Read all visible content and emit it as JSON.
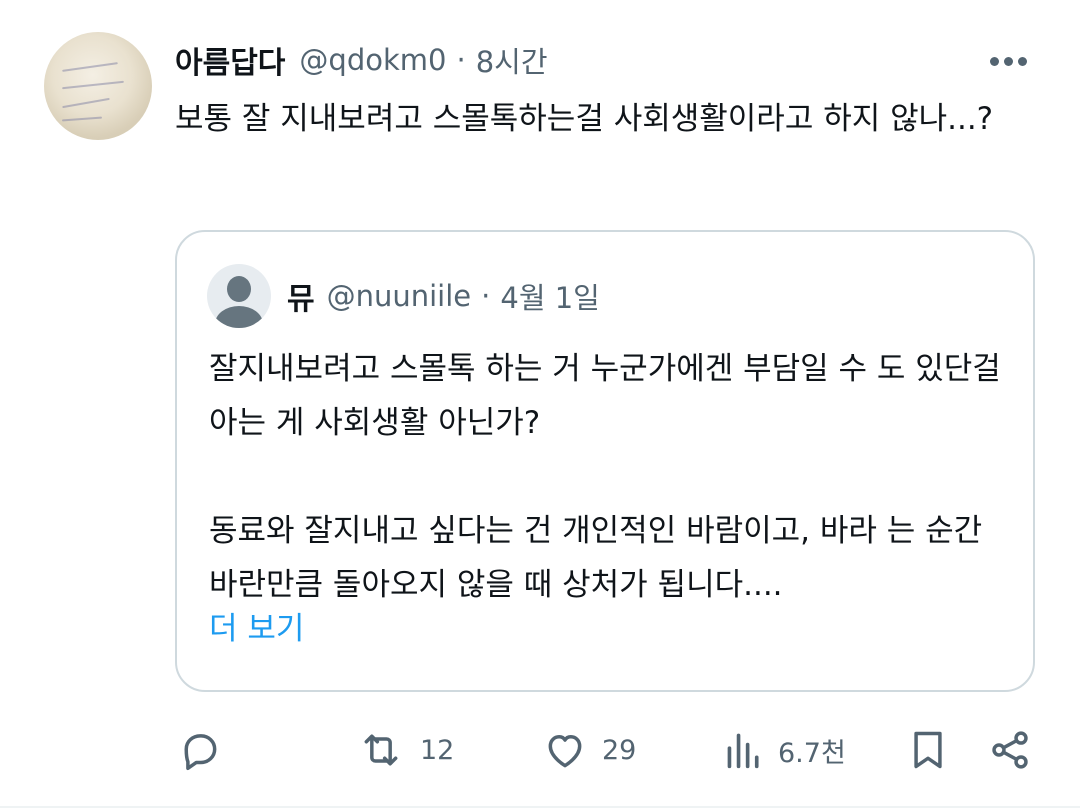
{
  "tweet": {
    "author_name": "아름답다",
    "handle": "@qdokm0",
    "separator": "·",
    "time": "8시간",
    "text": "보통 잘 지내보려고 스몰톡하는걸 사회생활이라고 하지 않나...?",
    "avatar_icon": "profile-photo"
  },
  "quoted_tweet": {
    "author_name": "뮤",
    "handle": "@nuuniile",
    "separator": "·",
    "date": "4월 1일",
    "paragraphs": [
      "잘지내보려고 스몰톡 하는 거 누군가에겐 부담일 수 도 있단걸 아는 게 사회생활 아닌가?",
      "동료와 잘지내고 싶다는 건 개인적인 바람이고, 바라 는 순간 바란만큼 돌아오지 않을 때 상처가 됩니다...."
    ],
    "show_more": "더 보기",
    "avatar_icon": "default-profile-icon"
  },
  "actions": {
    "reply": {
      "icon": "reply-icon",
      "count": ""
    },
    "retweet": {
      "icon": "retweet-icon",
      "count": "12"
    },
    "like": {
      "icon": "heart-icon",
      "count": "29"
    },
    "views": {
      "icon": "views-icon",
      "count": "6.7천"
    },
    "bookmark": {
      "icon": "bookmark-icon",
      "count": ""
    },
    "share": {
      "icon": "share-icon",
      "count": ""
    }
  },
  "colors": {
    "text_primary": "#0f1419",
    "text_secondary": "#536471",
    "link": "#1d9bf0",
    "border": "#cfd9de"
  }
}
